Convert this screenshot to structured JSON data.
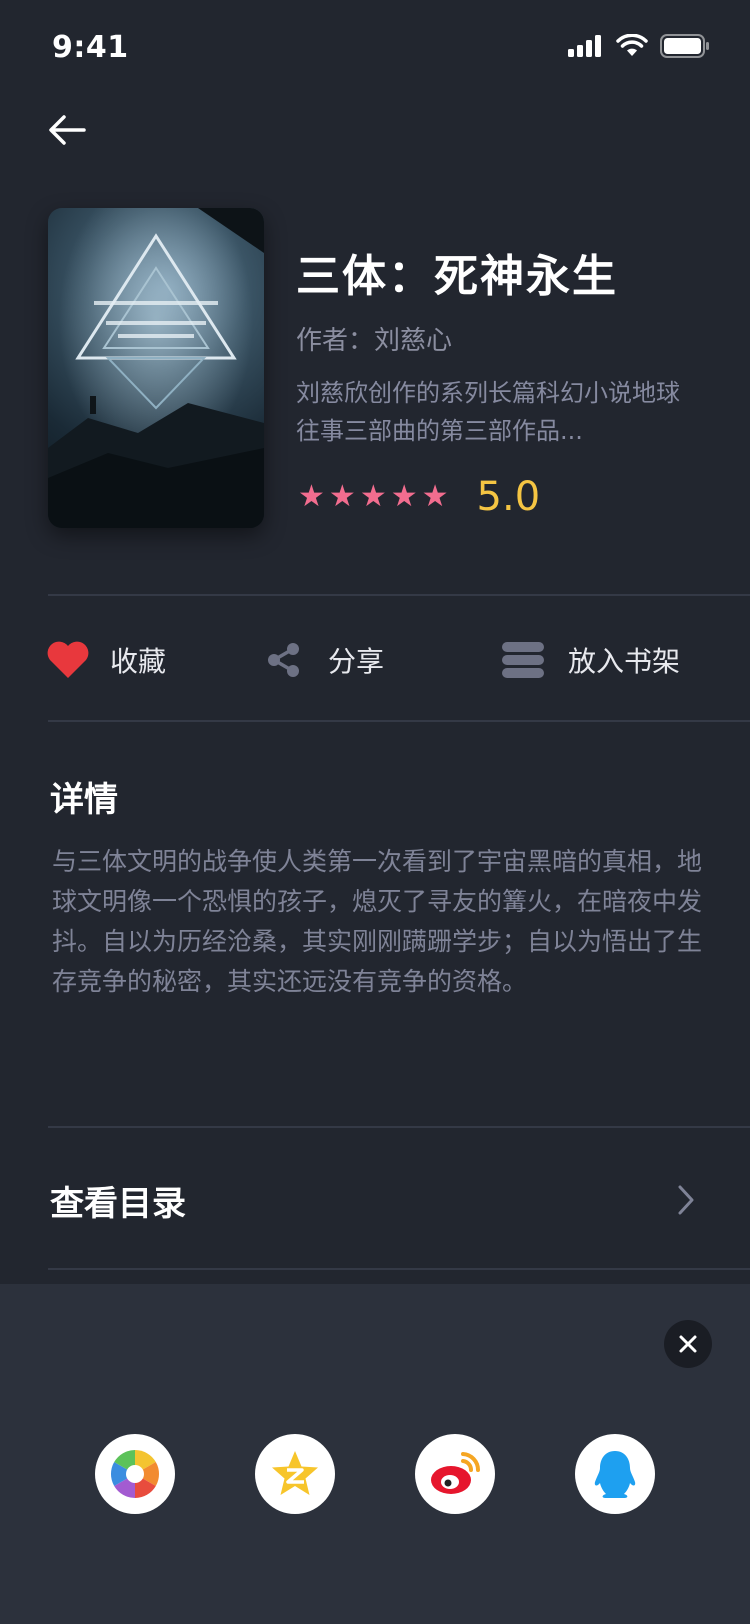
{
  "status": {
    "time": "9:41"
  },
  "book": {
    "title": "三体：死神永生",
    "author": "作者：刘慈心",
    "summary": "刘慈欣创作的系列长篇科幻小说地球往事三部曲的第三部作品...",
    "rating": "5.0",
    "stars": 5
  },
  "actions": {
    "favorite": "收藏",
    "share": "分享",
    "bookshelf": "放入书架"
  },
  "details": {
    "title": "详情",
    "text": "与三体文明的战争使人类第一次看到了宇宙黑暗的真相，地球文明像一个恐惧的孩子，熄灭了寻友的篝火，在暗夜中发抖。自以为历经沧桑，其实刚刚蹒跚学步；自以为悟出了生存竞争的秘密，其实还远没有竞争的资格。"
  },
  "toc": {
    "label": "查看目录"
  },
  "share_sheet": {
    "targets": [
      "photos",
      "qzone",
      "weibo",
      "qq"
    ]
  },
  "colors": {
    "background": "#22262f",
    "sheet": "#2c313c",
    "star": "#f26d8f",
    "rating": "#f5c543",
    "heart": "#e8383d"
  }
}
